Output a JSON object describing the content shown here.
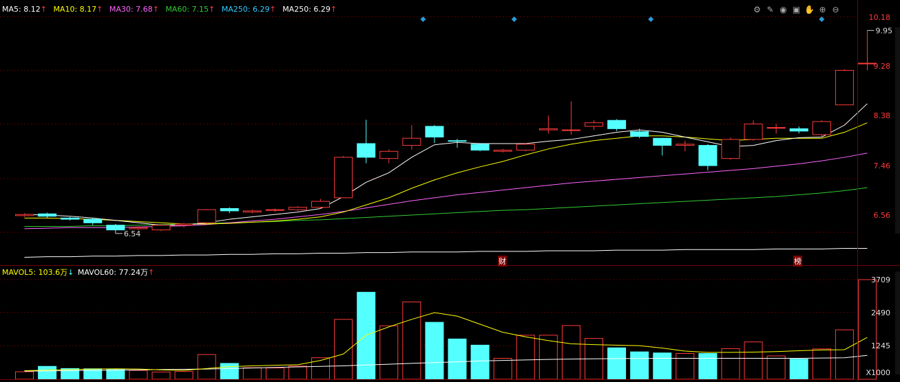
{
  "ma_legend": [
    {
      "label": "MA5: 8.12",
      "arrow": "↑",
      "color": "#ffffff"
    },
    {
      "label": "MA10: 8.17",
      "arrow": "↑",
      "color": "#ffff00"
    },
    {
      "label": "MA30: 7.68",
      "arrow": "↑",
      "color": "#ff66ff"
    },
    {
      "label": "MA60: 7.15",
      "arrow": "↑",
      "color": "#33cc33"
    },
    {
      "label": "MA250: 6.29",
      "arrow": "↑",
      "color": "#33ccff"
    },
    {
      "label": "MA250: 6.29",
      "arrow": "↑",
      "color": "#ffffff"
    }
  ],
  "vol_legend": [
    {
      "label": "MAVOL5: 103.6万",
      "arrow": "↓",
      "color": "#ffff00"
    },
    {
      "label": "MAVOL60: 77.24万",
      "arrow": "↑",
      "color": "#ffffff"
    }
  ],
  "toolbar": [
    "gear-icon",
    "pencil-icon",
    "eye-icon",
    "lock-icon",
    "hand-icon",
    "zoom-in-icon",
    "zoom-out-icon"
  ],
  "price_axis": [
    "10.18",
    "9.28",
    "8.38",
    "7.46",
    "6.56"
  ],
  "volume_axis": [
    "3709",
    "2490",
    "1245",
    "X1000"
  ],
  "annotations": {
    "high": "9.95",
    "low": "6.54",
    "event_cai": "财",
    "event_bang": "榜"
  },
  "colors": {
    "up": "#ff3b3b",
    "down": "#54ffff",
    "ma5": "#ffffff",
    "ma10": "#ffff00",
    "ma30": "#ff66ff",
    "ma60": "#33cc33",
    "ma250": "#ffffff",
    "bg": "#000000",
    "grid": "#5a0000"
  },
  "chart_data": [
    {
      "type": "candlestick",
      "ylim": [
        6.1,
        10.3
      ],
      "axis_ticks": [
        10.18,
        9.28,
        8.38,
        7.46,
        6.56
      ],
      "candles": [
        {
          "o": 6.84,
          "c": 6.86,
          "h": 6.88,
          "l": 6.82
        },
        {
          "o": 6.87,
          "c": 6.83,
          "h": 6.89,
          "l": 6.8
        },
        {
          "o": 6.8,
          "c": 6.78,
          "h": 6.82,
          "l": 6.76
        },
        {
          "o": 6.78,
          "c": 6.72,
          "h": 6.8,
          "l": 6.68
        },
        {
          "o": 6.68,
          "c": 6.6,
          "h": 6.7,
          "l": 6.54
        },
        {
          "o": 6.62,
          "c": 6.64,
          "h": 6.66,
          "l": 6.6
        },
        {
          "o": 6.6,
          "c": 6.68,
          "h": 6.7,
          "l": 6.58
        },
        {
          "o": 6.68,
          "c": 6.7,
          "h": 6.72,
          "l": 6.64
        },
        {
          "o": 6.72,
          "c": 6.94,
          "h": 6.95,
          "l": 6.7
        },
        {
          "o": 6.96,
          "c": 6.92,
          "h": 6.98,
          "l": 6.88
        },
        {
          "o": 6.9,
          "c": 6.92,
          "h": 6.94,
          "l": 6.88
        },
        {
          "o": 6.94,
          "c": 6.94,
          "h": 6.96,
          "l": 6.9
        },
        {
          "o": 6.94,
          "c": 6.98,
          "h": 7.0,
          "l": 6.92
        },
        {
          "o": 6.98,
          "c": 7.08,
          "h": 7.12,
          "l": 6.96
        },
        {
          "o": 7.14,
          "c": 7.82,
          "h": 7.84,
          "l": 7.14
        },
        {
          "o": 8.05,
          "c": 7.82,
          "h": 8.45,
          "l": 7.72
        },
        {
          "o": 7.8,
          "c": 7.92,
          "h": 7.95,
          "l": 7.72
        },
        {
          "o": 8.02,
          "c": 8.14,
          "h": 8.36,
          "l": 7.95
        },
        {
          "o": 8.34,
          "c": 8.16,
          "h": 8.36,
          "l": 8.06
        },
        {
          "o": 8.1,
          "c": 8.09,
          "h": 8.13,
          "l": 7.98
        },
        {
          "o": 8.04,
          "c": 7.94,
          "h": 8.06,
          "l": 7.92
        },
        {
          "o": 7.92,
          "c": 7.94,
          "h": 7.96,
          "l": 7.9
        },
        {
          "o": 7.94,
          "c": 8.04,
          "h": 8.06,
          "l": 7.92
        },
        {
          "o": 8.28,
          "c": 8.3,
          "h": 8.52,
          "l": 8.22
        },
        {
          "o": 8.28,
          "c": 8.28,
          "h": 8.76,
          "l": 8.2
        },
        {
          "o": 8.34,
          "c": 8.4,
          "h": 8.44,
          "l": 8.28
        },
        {
          "o": 8.44,
          "c": 8.3,
          "h": 8.46,
          "l": 8.26
        },
        {
          "o": 8.25,
          "c": 8.17,
          "h": 8.3,
          "l": 8.14
        },
        {
          "o": 8.14,
          "c": 8.02,
          "h": 8.14,
          "l": 7.85
        },
        {
          "o": 8.02,
          "c": 8.04,
          "h": 8.1,
          "l": 7.92
        },
        {
          "o": 8.02,
          "c": 7.68,
          "h": 8.04,
          "l": 7.6
        },
        {
          "o": 7.8,
          "c": 8.12,
          "h": 8.15,
          "l": 7.78
        },
        {
          "o": 8.12,
          "c": 8.38,
          "h": 8.44,
          "l": 8.1
        },
        {
          "o": 8.32,
          "c": 8.32,
          "h": 8.38,
          "l": 8.22
        },
        {
          "o": 8.3,
          "c": 8.26,
          "h": 8.34,
          "l": 8.22
        },
        {
          "o": 8.2,
          "c": 8.42,
          "h": 8.44,
          "l": 8.16
        },
        {
          "o": 8.7,
          "c": 9.28,
          "h": 9.3,
          "l": 8.7
        },
        {
          "o": 9.4,
          "c": 9.4,
          "h": 9.95,
          "l": 9.28
        }
      ],
      "ma5": [
        6.86,
        6.85,
        6.83,
        6.8,
        6.76,
        6.72,
        6.68,
        6.68,
        6.72,
        6.78,
        6.82,
        6.86,
        6.9,
        6.96,
        7.16,
        7.4,
        7.56,
        7.82,
        8.03,
        8.07,
        8.05,
        8.05,
        8.05,
        8.09,
        8.12,
        8.18,
        8.24,
        8.28,
        8.24,
        8.16,
        8.08,
        8.0,
        8.02,
        8.1,
        8.15,
        8.16,
        8.36,
        8.72
      ],
      "ma10": [
        6.8,
        6.8,
        6.79,
        6.78,
        6.76,
        6.74,
        6.72,
        6.7,
        6.7,
        6.71,
        6.73,
        6.75,
        6.78,
        6.82,
        6.9,
        7.02,
        7.14,
        7.3,
        7.44,
        7.56,
        7.66,
        7.75,
        7.86,
        7.96,
        8.04,
        8.1,
        8.14,
        8.18,
        8.18,
        8.16,
        8.13,
        8.1,
        8.12,
        8.14,
        8.14,
        8.14,
        8.24,
        8.4
      ],
      "ma30": [
        6.62,
        6.63,
        6.64,
        6.64,
        6.64,
        6.65,
        6.66,
        6.67,
        6.69,
        6.72,
        6.75,
        6.78,
        6.82,
        6.86,
        6.91,
        6.97,
        7.03,
        7.09,
        7.14,
        7.19,
        7.23,
        7.27,
        7.31,
        7.35,
        7.39,
        7.42,
        7.45,
        7.48,
        7.51,
        7.54,
        7.57,
        7.6,
        7.63,
        7.67,
        7.71,
        7.76,
        7.82,
        7.89
      ],
      "ma60": [
        6.66,
        6.66,
        6.66,
        6.67,
        6.67,
        6.68,
        6.69,
        6.7,
        6.71,
        6.72,
        6.73,
        6.74,
        6.76,
        6.77,
        6.79,
        6.81,
        6.83,
        6.85,
        6.87,
        6.89,
        6.91,
        6.93,
        6.94,
        6.96,
        6.98,
        7.0,
        7.02,
        7.04,
        7.06,
        7.08,
        7.1,
        7.12,
        7.14,
        7.16,
        7.19,
        7.22,
        7.26,
        7.31
      ],
      "ma250": [
        6.14,
        6.15,
        6.15,
        6.16,
        6.16,
        6.17,
        6.17,
        6.18,
        6.18,
        6.19,
        6.19,
        6.2,
        6.2,
        6.21,
        6.21,
        6.22,
        6.22,
        6.23,
        6.23,
        6.23,
        6.24,
        6.24,
        6.24,
        6.25,
        6.25,
        6.25,
        6.26,
        6.26,
        6.26,
        6.27,
        6.27,
        6.27,
        6.27,
        6.28,
        6.28,
        6.28,
        6.29,
        6.29
      ]
    },
    {
      "type": "bar",
      "ylim": [
        0,
        3709
      ],
      "axis_ticks": [
        3709,
        2490,
        1245
      ],
      "unit_label": "X1000",
      "volumes": [
        280,
        480,
        400,
        390,
        360,
        330,
        270,
        290,
        920,
        590,
        430,
        420,
        490,
        800,
        2230,
        3240,
        1990,
        2880,
        2120,
        1500,
        1270,
        780,
        1640,
        1640,
        2000,
        1520,
        1170,
        1020,
        980,
        960,
        960,
        1140,
        1390,
        870,
        750,
        1130,
        1840,
        3709
      ],
      "mavol5": [
        320,
        340,
        360,
        380,
        390,
        380,
        350,
        330,
        400,
        470,
        500,
        520,
        540,
        700,
        940,
        1640,
        1950,
        2230,
        2480,
        2350,
        2050,
        1750,
        1580,
        1440,
        1320,
        1290,
        1270,
        1250,
        1160,
        1050,
        1000,
        1000,
        1010,
        1030,
        1060,
        1090,
        1100,
        1560
      ],
      "mavol60": [
        300,
        310,
        320,
        330,
        340,
        350,
        360,
        370,
        380,
        400,
        420,
        440,
        460,
        480,
        500,
        530,
        560,
        590,
        620,
        650,
        680,
        700,
        720,
        740,
        750,
        760,
        770,
        775,
        780,
        780,
        780,
        780,
        780,
        780,
        780,
        790,
        800,
        890
      ]
    }
  ]
}
